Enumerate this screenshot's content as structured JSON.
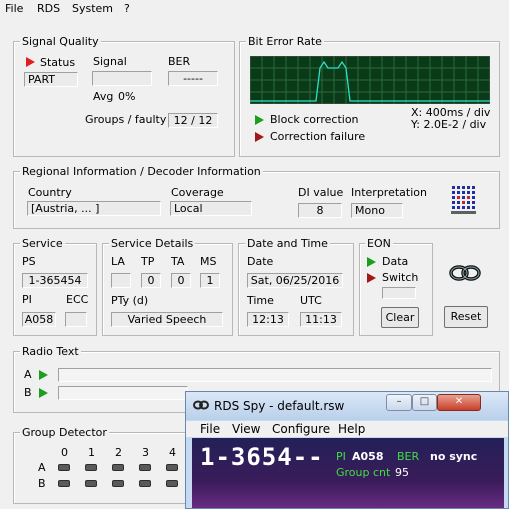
{
  "menu": {
    "file": "File",
    "rds": "RDS",
    "system": "System",
    "help": "?"
  },
  "signal_quality": {
    "title": "Signal Quality",
    "status_label": "Status",
    "status_value": "PART",
    "signal_label": "Signal",
    "signal_value": "",
    "ber_label": "BER",
    "ber_value": "-----",
    "avg_label": "Avg",
    "avg_value": "0%",
    "groups_label": "Groups / faulty",
    "groups_value": "12 / 12"
  },
  "bit_error_rate": {
    "title": "Bit Error Rate",
    "block_correction": "Block correction",
    "correction_failure": "Correction failure",
    "x_scale": "X: 400ms / div",
    "y_scale": "Y: 2.0E-2 / div"
  },
  "regional": {
    "title": "Regional Information / Decoder Information",
    "country_label": "Country",
    "country_value": "[Austria, ... ]",
    "coverage_label": "Coverage",
    "coverage_value": "Local",
    "di_label": "DI value",
    "di_value": "8",
    "interp_label": "Interpretation",
    "interp_value": "Mono"
  },
  "service": {
    "title": "Service",
    "ps_label": "PS",
    "ps_value": "1-365454",
    "pi_label": "PI",
    "pi_value": "A058",
    "ecc_label": "ECC",
    "ecc_value": ""
  },
  "service_details": {
    "title": "Service Details",
    "la_label": "LA",
    "la_value": "",
    "tp_label": "TP",
    "tp_value": "0",
    "ta_label": "TA",
    "ta_value": "0",
    "ms_label": "MS",
    "ms_value": "1",
    "pty_label": "PTy (d)",
    "pty_value": "Varied Speech"
  },
  "date_time": {
    "title": "Date and Time",
    "date_label": "Date",
    "date_value": "Sat, 06/25/2016",
    "time_label": "Time",
    "time_value": "12:13",
    "utc_label": "UTC",
    "utc_value": "11:13"
  },
  "eon": {
    "title": "EON",
    "data_label": "Data",
    "switch_label": "Switch",
    "clear_button": "Clear"
  },
  "reset_button": "Reset",
  "radio_text": {
    "title": "Radio Text",
    "a_label": "A",
    "b_label": "B"
  },
  "group_detector": {
    "title": "Group Detector",
    "columns": [
      "0",
      "1",
      "2",
      "3",
      "4"
    ],
    "row_a": "A",
    "row_b": "B"
  },
  "mini_window": {
    "title": "RDS Spy - default.rsw",
    "menu": [
      "File",
      "View",
      "Configure",
      "Help"
    ],
    "ps_display": "1-3654--",
    "pi_label": "PI",
    "pi_value": "A058",
    "ber_label": "BER",
    "ber_value": "no sync",
    "group_cnt_label": "Group cnt",
    "group_cnt_value": "95"
  },
  "colors": {
    "green": "#1e9e1e",
    "red": "#e02020",
    "scope_bg": "#0b3a18",
    "scope_trace": "#2ce0c8"
  }
}
